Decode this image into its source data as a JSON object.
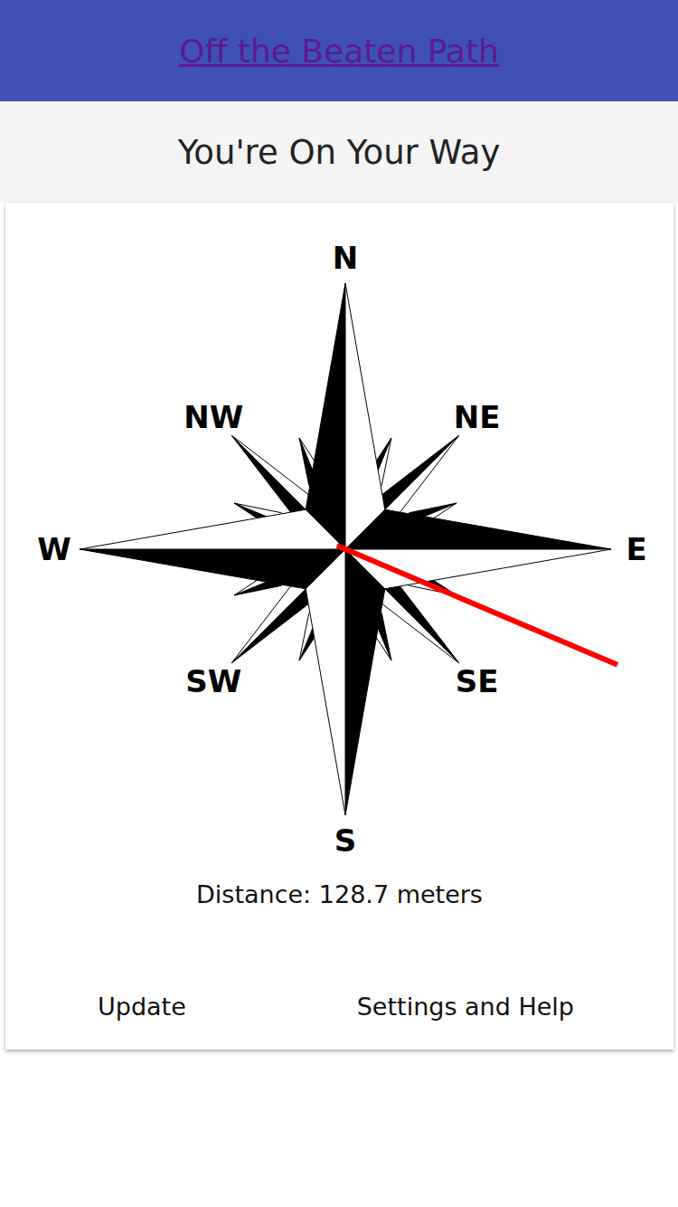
{
  "header": {
    "title": "Off the Beaten Path"
  },
  "subtitle": "You're On Your Way",
  "compass": {
    "labels": [
      "N",
      "NE",
      "E",
      "SE",
      "S",
      "SW",
      "W",
      "NW"
    ],
    "needle": {
      "bearing": 113,
      "color": "#ff0000"
    }
  },
  "distance": "Distance: 128.7 meters",
  "buttons": [
    "Update",
    "Settings and Help"
  ]
}
